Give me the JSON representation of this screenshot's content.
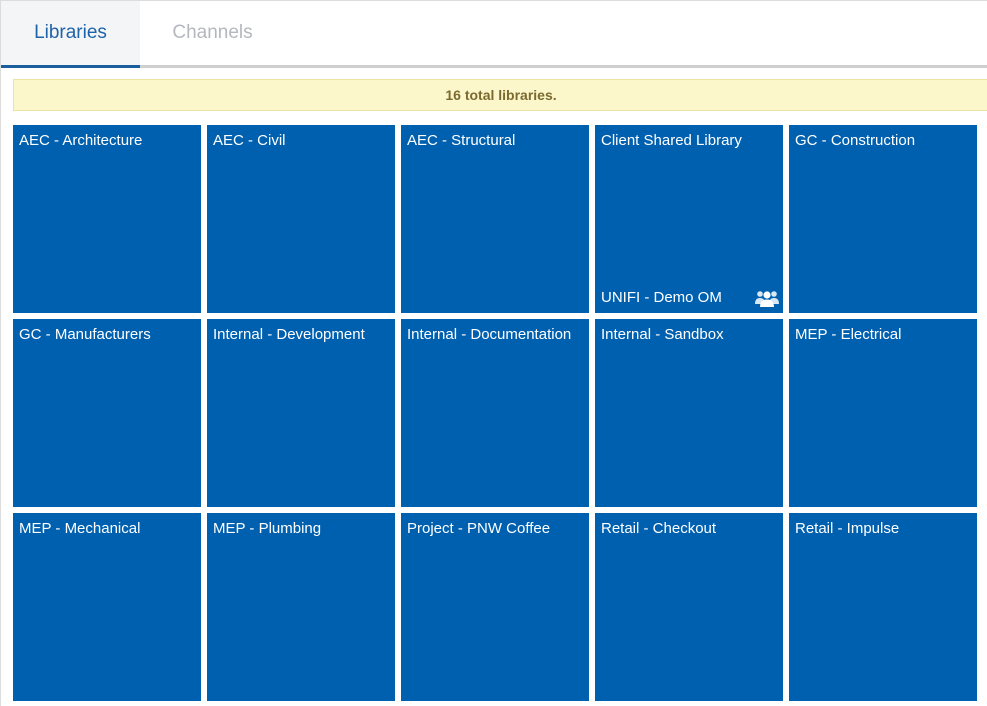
{
  "tabs": {
    "libraries": "Libraries",
    "channels": "Channels"
  },
  "notice": {
    "text": "16 total libraries."
  },
  "libraries": [
    {
      "name": "AEC - Architecture"
    },
    {
      "name": "AEC - Civil"
    },
    {
      "name": "AEC - Structural"
    },
    {
      "name": "Client Shared Library",
      "shared_with": "UNIFI - Demo OM",
      "icon": "shared-users-icon"
    },
    {
      "name": "GC - Construction"
    },
    {
      "name": "GC - Manufacturers"
    },
    {
      "name": "Internal - Development"
    },
    {
      "name": "Internal - Documentation"
    },
    {
      "name": "Internal - Sandbox"
    },
    {
      "name": "MEP - Electrical"
    },
    {
      "name": "MEP - Mechanical"
    },
    {
      "name": "MEP - Plumbing"
    },
    {
      "name": "Project - PNW Coffee"
    },
    {
      "name": "Retail - Checkout"
    },
    {
      "name": "Retail - Impulse"
    }
  ],
  "colors": {
    "tile": "#0060b0",
    "active_tab_text": "#1e63a8",
    "notice_bg": "#fbf7cb",
    "notice_text": "#7a6a2e"
  }
}
